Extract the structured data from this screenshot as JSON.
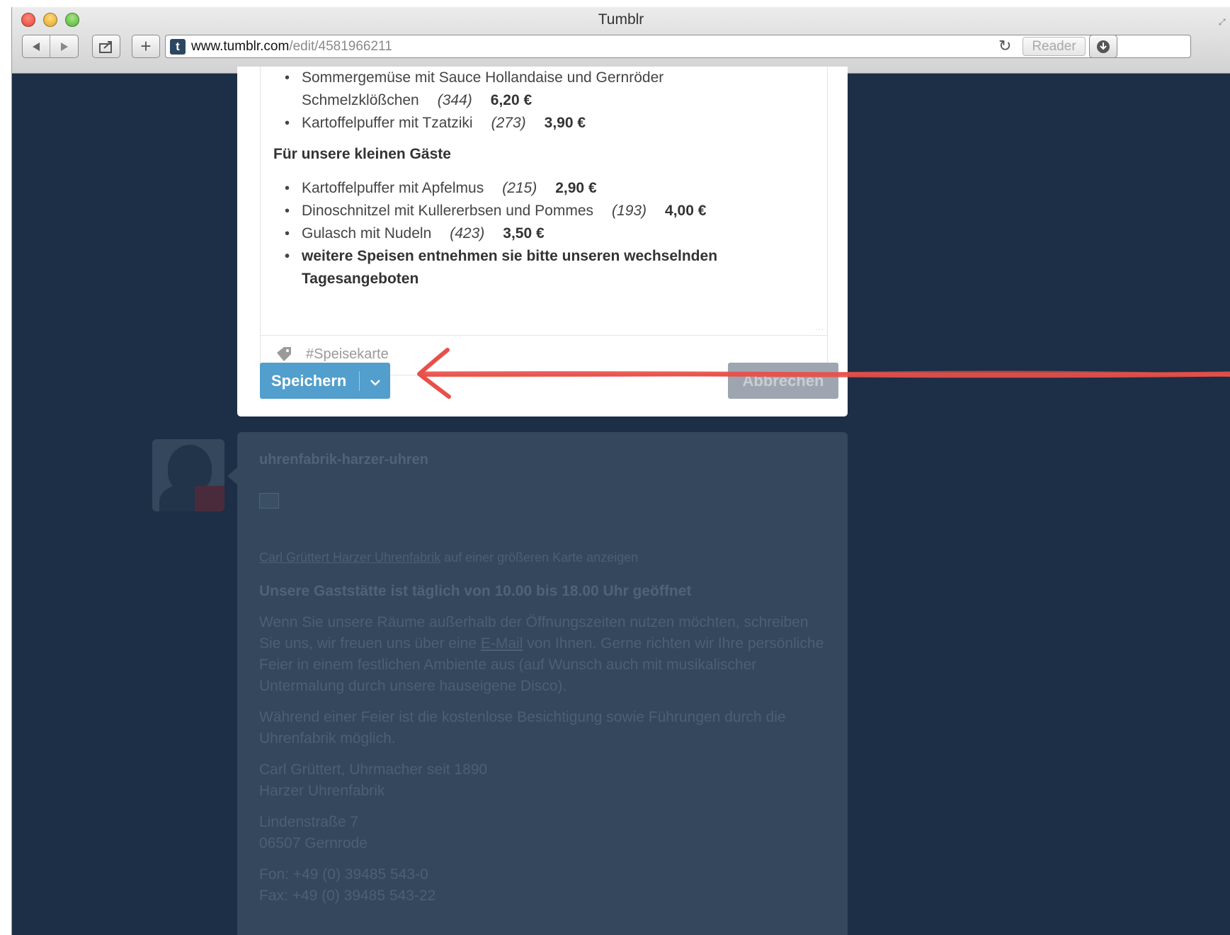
{
  "browser": {
    "window_title": "Tumblr",
    "url_host": "www.tumblr.com",
    "url_path": "/edit/4581966211",
    "reader_label": "Reader",
    "favicon_letter": "t"
  },
  "editor": {
    "menu_top": [
      {
        "name": "Sommergemüse mit Sauce Hollandaise und Gernröder Schmelzklößchen",
        "count": "(344)",
        "price": "6,20 €",
        "wrapped": true,
        "line1": "Sommergemüse mit Sauce Hollandaise und Gernröder",
        "line2": "Schmelzklößchen"
      },
      {
        "name": "Kartoffelpuffer mit Tzatziki",
        "count": "(273)",
        "price": "3,90 €"
      }
    ],
    "section_heading": "Für unsere kleinen Gäste",
    "menu_kids": [
      {
        "name": "Kartoffelpuffer mit Apfelmus",
        "count": "(215)",
        "price": "2,90 €"
      },
      {
        "name": "Dinoschnitzel mit Kullererbsen und Pommes",
        "count": "(193)",
        "price": "4,00 €"
      },
      {
        "name": "Gulasch mit Nudeln",
        "count": "(423)",
        "price": "3,50 €"
      }
    ],
    "note_line1": "weitere Speisen entnehmen sie bitte unseren wechselnden",
    "note_line2": "Tagesangeboten",
    "tag": "#Speisekarte",
    "save_label": "Speichern",
    "cancel_label": "Abbrechen"
  },
  "next_post": {
    "username": "uhrenfabrik-harzer-uhren",
    "caption_link": "Carl Grüttert Harzer Uhrenfabrik",
    "caption_rest": " auf einer größeren Karte anzeigen",
    "heading": "Unsere Gaststätte ist täglich von 10.00 bis 18.00 Uhr geöffnet",
    "p1_before": "Wenn Sie unsere Räume außerhalb der Öffnungszeiten nutzen möchten, schreiben Sie uns, wir freuen uns über eine ",
    "p1_link": "E-Mail",
    "p1_after": " von Ihnen. Gerne richten wir Ihre persönliche Feier in einem festlichen Ambiente aus (auf Wunsch auch mit musikalischer Untermalung durch unsere hauseigene Disco).",
    "p2": "Während einer Feier ist die kostenlose Besichtigung sowie Führungen durch die Uhrenfabrik möglich.",
    "addr1": "Carl Grüttert, Uhrmacher seit 1890",
    "addr2": "Harzer Uhrenfabrik",
    "addr3": "Lindenstraße 7",
    "addr4": "06507 Gernrode",
    "phone": "Fon: +49 (0) 39485 543-0",
    "fax": "Fax: +49 (0) 39485 543-22"
  },
  "colors": {
    "dashboard_bg": "#1c2f46",
    "save_button": "#529ecc",
    "annotation_red": "#e8504a"
  }
}
